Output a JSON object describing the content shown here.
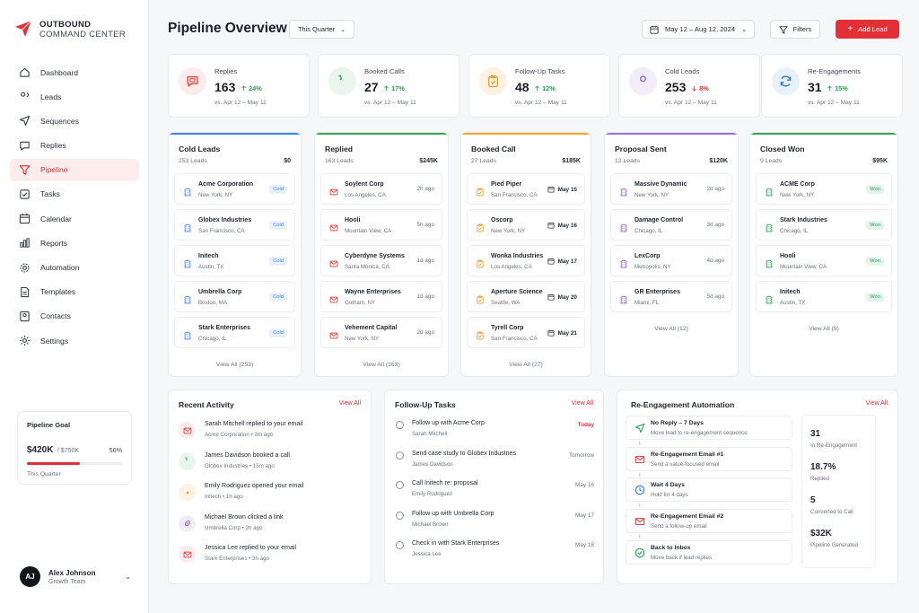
{
  "brand": {
    "line1": "OUTBOUND",
    "line2": "COMMAND CENTER"
  },
  "nav": [
    {
      "label": "Dashboard",
      "icon": "home-icon"
    },
    {
      "label": "Leads",
      "icon": "users-icon"
    },
    {
      "label": "Sequences",
      "icon": "send-icon"
    },
    {
      "label": "Replies",
      "icon": "message-icon"
    },
    {
      "label": "Pipeline",
      "icon": "funnel-icon",
      "active": true
    },
    {
      "label": "Tasks",
      "icon": "checkbox-icon"
    },
    {
      "label": "Calendar",
      "icon": "calendar-icon"
    },
    {
      "label": "Reports",
      "icon": "chart-icon"
    },
    {
      "label": "Automation",
      "icon": "gear-icon"
    },
    {
      "label": "Templates",
      "icon": "document-icon"
    },
    {
      "label": "Contacts",
      "icon": "contacts-icon"
    },
    {
      "label": "Settings",
      "icon": "settings-icon"
    }
  ],
  "goal": {
    "title": "Pipeline Goal",
    "current": "$420K",
    "target": "/ $750K",
    "percent": "56%",
    "progress": 0.56,
    "period": "This Quarter"
  },
  "user": {
    "initials": "AJ",
    "name": "Alex Johnson",
    "role": "Growth Team"
  },
  "header": {
    "title": "Pipeline Overview",
    "quarter": "This Quarter",
    "date_range": "May 12 – Aug 12, 2024",
    "filters": "Filters",
    "add_lead": "Add Lead"
  },
  "stats": [
    {
      "label": "Replies",
      "value": "163",
      "change": "24%",
      "direction": "up",
      "compare": "vs. Apr 12 – May 11",
      "icon": "reply-icon",
      "color": "#e04848",
      "bg": "#fdeceb"
    },
    {
      "label": "Booked Calls",
      "value": "27",
      "change": "17%",
      "direction": "up",
      "compare": "vs. Apr 12 – May 11",
      "icon": "phone-icon",
      "color": "#2e9b55",
      "bg": "#e8f6ed"
    },
    {
      "label": "Follow-Up Tasks",
      "value": "48",
      "change": "12%",
      "direction": "up",
      "compare": "vs. Apr 12 – May 11",
      "icon": "clipboard-icon",
      "color": "#e59a2b",
      "bg": "#fdf2e3"
    },
    {
      "label": "Cold Leads",
      "value": "253",
      "change": "8%",
      "direction": "down",
      "compare": "vs. Apr 12 – May 11",
      "icon": "user-icon",
      "color": "#8a5bd6",
      "bg": "#f2ecfb"
    },
    {
      "label": "Re-Engagements",
      "value": "31",
      "change": "15%",
      "direction": "up",
      "compare": "vs. Apr 12 – May 11",
      "icon": "refresh-icon",
      "color": "#2f7fd8",
      "bg": "#e9f2fc"
    }
  ],
  "columns": [
    {
      "title": "Cold Leads",
      "count": "253 Leads",
      "value": "$0",
      "accent": "#3b82f6",
      "kind": "badge",
      "badge_color": "#3b82f6",
      "badge_bg": "#e8f1fd",
      "view_all": "View All (253)",
      "cards": [
        {
          "name": "Acme Corporation",
          "loc": "New York, NY",
          "tag": "Cold"
        },
        {
          "name": "Globex Industries",
          "loc": "San Francisco, CA",
          "tag": "Cold"
        },
        {
          "name": "Initech",
          "loc": "Austin, TX",
          "tag": "Cold"
        },
        {
          "name": "Umbrella Corp",
          "loc": "Boston, MA",
          "tag": "Cold"
        },
        {
          "name": "Stark Enterprises",
          "loc": "Chicago, IL",
          "tag": "Cold"
        }
      ]
    },
    {
      "title": "Replied",
      "count": "163 Leads",
      "value": "$245K",
      "accent": "#34a853",
      "kind": "time",
      "icon_color": "#e04848",
      "view_all": "View All (163)",
      "cards": [
        {
          "name": "Soylent Corp",
          "loc": "Los Angeles, CA",
          "tag": "2h ago"
        },
        {
          "name": "Hooli",
          "loc": "Mountain View, CA",
          "tag": "5h ago"
        },
        {
          "name": "Cyberdyne Systems",
          "loc": "Santa Monica, CA",
          "tag": "1d ago"
        },
        {
          "name": "Wayne Enterprises",
          "loc": "Gotham, NY",
          "tag": "1d ago"
        },
        {
          "name": "Vehement Capital",
          "loc": "New York, NY",
          "tag": "2d ago"
        }
      ]
    },
    {
      "title": "Booked Call",
      "count": "27 Leads",
      "value": "$185K",
      "accent": "#f5a524",
      "kind": "date",
      "icon_color": "#e59a2b",
      "view_all": "View All (27)",
      "cards": [
        {
          "name": "Pied Piper",
          "loc": "San Francisco, CA",
          "tag": "May 15"
        },
        {
          "name": "Oscorp",
          "loc": "New York, NY",
          "tag": "May 16"
        },
        {
          "name": "Wonka Industries",
          "loc": "Los Angeles, CA",
          "tag": "May 17"
        },
        {
          "name": "Aperture Science",
          "loc": "Seattle, WA",
          "tag": "May 20"
        },
        {
          "name": "Tyrell Corp",
          "loc": "San Francisco, CA",
          "tag": "May 21"
        }
      ]
    },
    {
      "title": "Proposal Sent",
      "count": "12 Leads",
      "value": "$120K",
      "accent": "#9b6ee6",
      "kind": "time",
      "icon_color": "#8a5bd6",
      "view_all": "View All (12)",
      "cards": [
        {
          "name": "Massive Dynamic",
          "loc": "New York, NY",
          "tag": "2d ago"
        },
        {
          "name": "Damage Control",
          "loc": "Chicago, IL",
          "tag": "3d ago"
        },
        {
          "name": "LexCorp",
          "loc": "Metropolis, NY",
          "tag": "4d ago"
        },
        {
          "name": "GR Enterprises",
          "loc": "Miami, FL",
          "tag": "5d ago"
        }
      ]
    },
    {
      "title": "Closed Won",
      "count": "9 Leads",
      "value": "$95K",
      "accent": "#34a853",
      "kind": "badge",
      "badge_color": "#2e9b55",
      "badge_bg": "#e6f5ea",
      "view_all": "View All (9)",
      "cards": [
        {
          "name": "ACME Corp",
          "loc": "New York, NY",
          "tag": "Won"
        },
        {
          "name": "Stark Industries",
          "loc": "Chicago, IL",
          "tag": "Won"
        },
        {
          "name": "Hooli",
          "loc": "Mountain View, CA",
          "tag": "Won"
        },
        {
          "name": "Initech",
          "loc": "Austin, TX",
          "tag": "Won"
        }
      ]
    }
  ],
  "recent_activity": {
    "title": "Recent Activity",
    "view_all": "View All",
    "items": [
      {
        "text": "Sarah Mitchell replied to your email",
        "sub": "Acme Corporation  •  2m ago",
        "icon": "mail-icon",
        "color": "#e04848",
        "bg": "#fdeceb"
      },
      {
        "text": "James Davidson booked a call",
        "sub": "Globex Industries  •  15m ago",
        "icon": "phone-icon",
        "color": "#2e9b55",
        "bg": "#e8f6ed"
      },
      {
        "text": "Emily Rodriguez opened your email",
        "sub": "Initech  •  1h ago",
        "icon": "eye-icon",
        "color": "#e59a2b",
        "bg": "#fdf2e3"
      },
      {
        "text": "Michael Brown clicked a link",
        "sub": "Umbrella Corp  •  2h ago",
        "icon": "link-icon",
        "color": "#8a5bd6",
        "bg": "#f2ecfb"
      },
      {
        "text": "Jessica Lee replied to your email",
        "sub": "Stark Enterprises  •  3h ago",
        "icon": "mail-icon",
        "color": "#e04848",
        "bg": "#fdeceb"
      }
    ]
  },
  "follow_up": {
    "title": "Follow-Up Tasks",
    "view_all": "View All",
    "items": [
      {
        "text": "Follow up with Acme Corp",
        "sub": "Sarah Mitchell",
        "due": "Today",
        "today": true
      },
      {
        "text": "Send case study to Globex Industries",
        "sub": "James Davidson",
        "due": "Tomorrow"
      },
      {
        "text": "Call Initech re: proposal",
        "sub": "Emily Rodriguez",
        "due": "May 16"
      },
      {
        "text": "Follow up with Umbrella Corp",
        "sub": "Michael Brown",
        "due": "May 17"
      },
      {
        "text": "Check in with Stark Enterprises",
        "sub": "Jessica Lee",
        "due": "May 18"
      }
    ]
  },
  "reengagement": {
    "title": "Re-Engagement Automation",
    "view_all": "View All",
    "steps": [
      {
        "title": "No Reply – 7 Days",
        "sub": "Move lead to re-engagement sequence",
        "icon": "send-icon",
        "color": "#2e9b55"
      },
      {
        "title": "Re-Engagement Email #1",
        "sub": "Send a value-focused email",
        "icon": "mail-icon",
        "color": "#e04848"
      },
      {
        "title": "Wait 4 Days",
        "sub": "Hold for 4 days",
        "icon": "clock-icon",
        "color": "#2f7fd8"
      },
      {
        "title": "Re-Engagement Email #2",
        "sub": "Send a follow-up email",
        "icon": "mail-icon",
        "color": "#e04848"
      },
      {
        "title": "Back to Inbox",
        "sub": "Move back if lead replies",
        "icon": "check-circle-icon",
        "color": "#2e9b55"
      }
    ],
    "metrics": [
      {
        "value": "31",
        "label": "In Re-Engagement"
      },
      {
        "value": "18.7%",
        "label": "Replied"
      },
      {
        "value": "5",
        "label": "Converted to Call"
      },
      {
        "value": "$32K",
        "label": "Pipeline Generated"
      }
    ]
  }
}
